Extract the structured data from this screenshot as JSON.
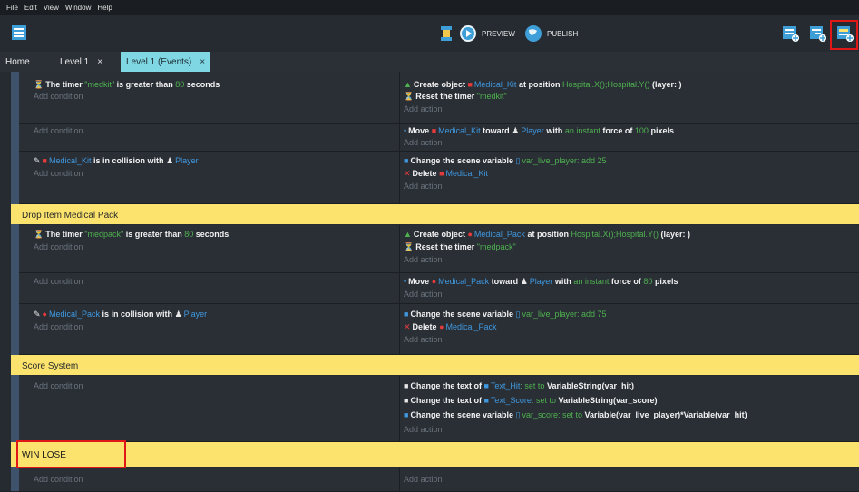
{
  "menu": [
    "File",
    "Edit",
    "View",
    "Window",
    "Help"
  ],
  "toolbar": {
    "preview_label": "PREVIEW",
    "publish_label": "PUBLISH"
  },
  "tabs": [
    {
      "label": "Home"
    },
    {
      "label": "Level 1",
      "close": "×"
    },
    {
      "label": "Level 1 (Events)",
      "close": "×"
    }
  ],
  "events": {
    "add_condition": "Add condition",
    "add_action": "Add action",
    "e1": {
      "cond": {
        "text": "The timer",
        "timer": "\"medkit\"",
        "mid": "is greater than",
        "num": "80",
        "tail": "seconds"
      },
      "a1": {
        "pre": "Create object",
        "obj": "Medical_Kit",
        "mid": "at position",
        "pos": "Hospital.X();Hospital.Y()",
        "layer": "(layer: )"
      },
      "a2": {
        "pre": "Reset the timer",
        "timer": "\"medkit\""
      }
    },
    "e2": {
      "a1": {
        "pre": "Move",
        "obj": "Medical_Kit",
        "mid": "toward",
        "target": "Player",
        "with": "with",
        "force": "an instant",
        "mid2": "force of",
        "num": "100",
        "tail": "pixels"
      }
    },
    "e3": {
      "cond": {
        "obj": "Medical_Kit",
        "mid": "is in collision with",
        "target": "Player"
      },
      "a1": {
        "pre": "Change the scene variable",
        "var": "var_live_player",
        "op": ": add",
        "num": "25"
      },
      "a2": {
        "pre": "Delete",
        "obj": "Medical_Kit"
      }
    },
    "group1": "Drop Item Medical Pack",
    "e4": {
      "cond": {
        "text": "The timer",
        "timer": "\"medpack\"",
        "mid": "is greater than",
        "num": "80",
        "tail": "seconds"
      },
      "a1": {
        "pre": "Create object",
        "obj": "Medical_Pack",
        "mid": "at position",
        "pos": "Hospital.X();Hospital.Y()",
        "layer": "(layer: )"
      },
      "a2": {
        "pre": "Reset the timer",
        "timer": "\"medpack\""
      }
    },
    "e5": {
      "a1": {
        "pre": "Move",
        "obj": "Medical_Pack",
        "mid": "toward",
        "target": "Player",
        "with": "with",
        "force": "an instant",
        "mid2": "force of",
        "num": "80",
        "tail": "pixels"
      }
    },
    "e6": {
      "cond": {
        "obj": "Medical_Pack",
        "mid": "is in collision with",
        "target": "Player"
      },
      "a1": {
        "pre": "Change the scene variable",
        "var": "var_live_player",
        "op": ": add",
        "num": "75"
      },
      "a2": {
        "pre": "Delete",
        "obj": "Medical_Pack"
      }
    },
    "group2": "Score System",
    "e7": {
      "a1": {
        "pre": "Change the text of",
        "obj": "Text_Hit",
        "op": ": set to",
        "val": "VariableString(var_hit)"
      },
      "a2": {
        "pre": "Change the text of",
        "obj": "Text_Score",
        "op": ": set to",
        "val": "VariableString(var_score)"
      },
      "a3": {
        "pre": "Change the scene variable",
        "var": "var_score",
        "op": ": set to",
        "val": "Variable(var_live_player)*Variable(var_hit)"
      }
    },
    "group3": "WIN LOSE"
  },
  "colors": {
    "accent_tab": "#7fd7e4",
    "group_bar": "#fbe36e",
    "highlight_box": "#e01818",
    "blue_param": "#3f98de",
    "green_num": "#4fb14f"
  }
}
